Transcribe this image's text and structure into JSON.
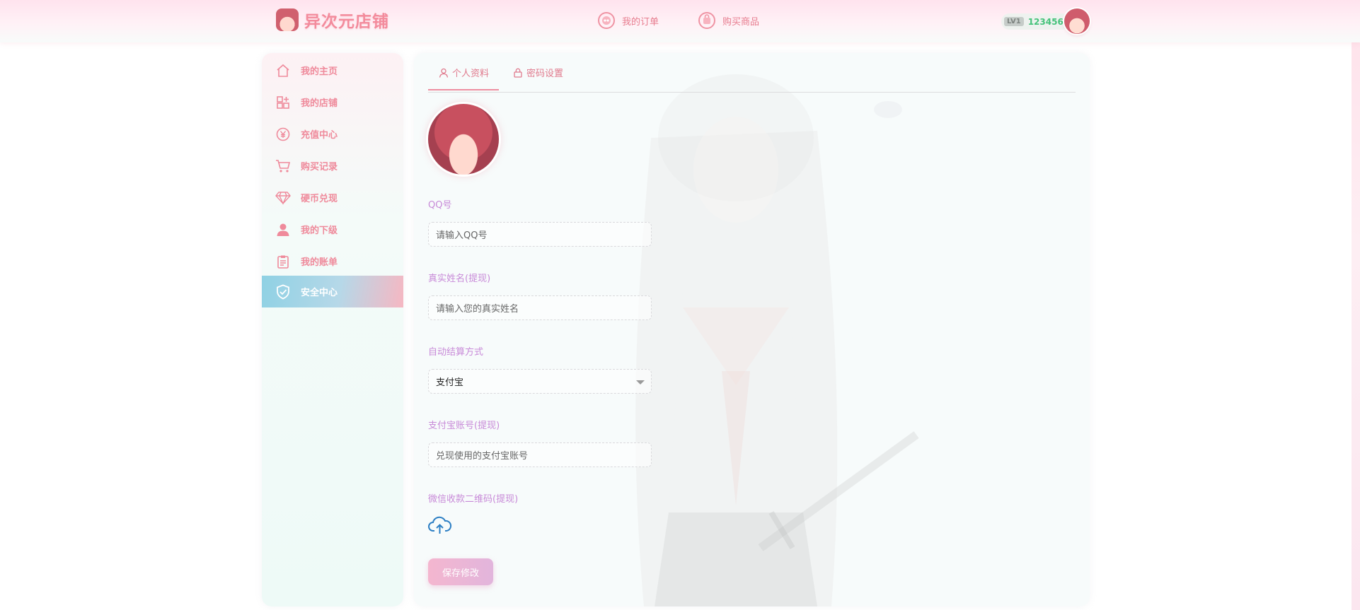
{
  "brand": {
    "name": "异次元店铺"
  },
  "nav": {
    "orders": "我的订单",
    "buy": "购买商品"
  },
  "user": {
    "level": "LV1",
    "balance": "123456"
  },
  "sidebar": {
    "items": [
      {
        "label": "我的主页",
        "icon": "home-icon"
      },
      {
        "label": "我的店铺",
        "icon": "shop-grid-icon"
      },
      {
        "label": "充值中心",
        "icon": "yen-icon"
      },
      {
        "label": "购买记录",
        "icon": "cart-icon"
      },
      {
        "label": "硬币兑现",
        "icon": "diamond-icon"
      },
      {
        "label": "我的下级",
        "icon": "user-icon"
      },
      {
        "label": "我的账单",
        "icon": "clipboard-icon"
      },
      {
        "label": "安全中心",
        "icon": "shield-check-icon"
      }
    ],
    "active_index": 7
  },
  "tabs": {
    "profile": "个人资料",
    "password": "密码设置"
  },
  "form": {
    "qq_label": "QQ号",
    "qq_placeholder": "请输入QQ号",
    "name_label": "真实姓名(提现)",
    "name_placeholder": "请输入您的真实姓名",
    "settle_label": "自动结算方式",
    "settle_value": "支付宝",
    "alipay_label": "支付宝账号(提现)",
    "alipay_placeholder": "兑现使用的支付宝账号",
    "wechat_label": "微信收款二维码(提现)",
    "save_label": "保存修改"
  },
  "colors": {
    "accent": "#ef8a9b",
    "label": "#c88ad8",
    "balance": "#45c27a",
    "active_start": "#8fd1e4",
    "active_end": "#f6b7c2"
  }
}
